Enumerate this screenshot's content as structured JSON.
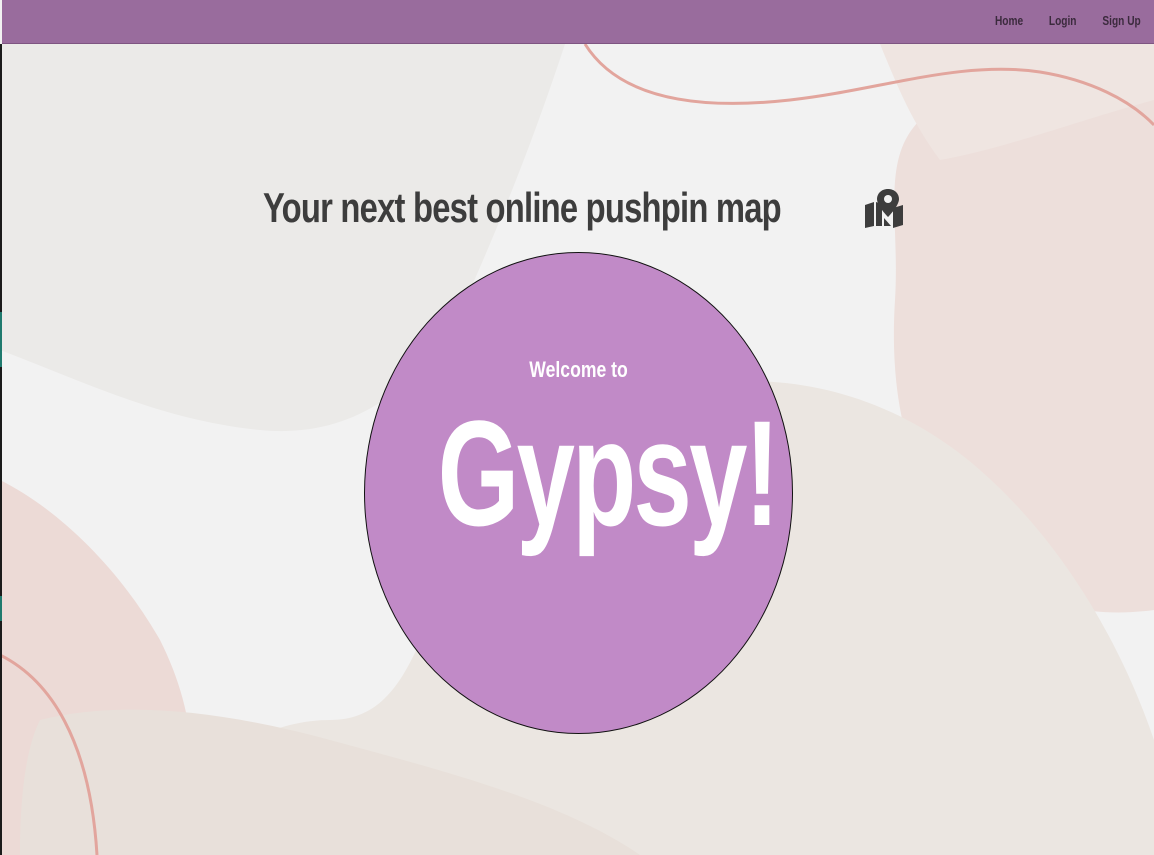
{
  "nav": {
    "items": [
      {
        "label": "Home"
      },
      {
        "label": "Login"
      },
      {
        "label": "Sign Up"
      }
    ]
  },
  "hero": {
    "headline": "Your next best online pushpin map",
    "headline_icon": "map-location-icon",
    "welcome": "Welcome to",
    "brand": "Gypsy!"
  },
  "colors": {
    "navbar": "#996c9d",
    "circle": "#c18ac7",
    "headline_text": "#3d3d3d",
    "background": "#f2f2f2",
    "accent_line": "#e0a09a"
  }
}
